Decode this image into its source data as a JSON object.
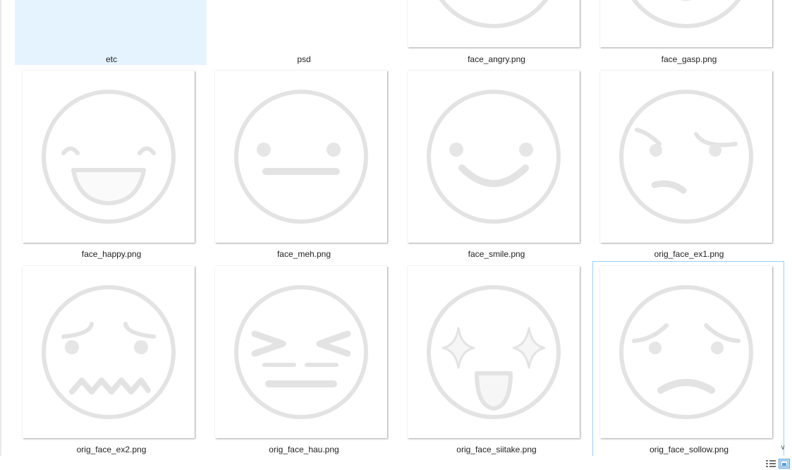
{
  "items": [
    {
      "label": "etc",
      "kind": "folder",
      "icon": "folder-icon"
    },
    {
      "label": "psd",
      "kind": "folder",
      "icon": "folder-icon"
    },
    {
      "label": "face_angry.png",
      "kind": "image",
      "face": "face-angry"
    },
    {
      "label": "face_gasp.png",
      "kind": "image",
      "face": "face-gasp"
    },
    {
      "label": "face_happy.png",
      "kind": "image",
      "face": "face-happy"
    },
    {
      "label": "face_meh.png",
      "kind": "image",
      "face": "face-meh"
    },
    {
      "label": "face_smile.png",
      "kind": "image",
      "face": "face-smile"
    },
    {
      "label": "orig_face_ex1.png",
      "kind": "image",
      "face": "face-ex1"
    },
    {
      "label": "orig_face_ex2.png",
      "kind": "image",
      "face": "face-ex2"
    },
    {
      "label": "orig_face_hau.png",
      "kind": "image",
      "face": "face-hau"
    },
    {
      "label": "orig_face_siitake.png",
      "kind": "image",
      "face": "face-siitake"
    },
    {
      "label": "orig_face_sollow.png",
      "kind": "image",
      "face": "face-sollow"
    }
  ],
  "selected_item": "etc",
  "focused_item": "orig_face_sollow.png",
  "statusbar": {
    "details_view_icon": "details-view-icon",
    "large_icons_view_icon": "large-icons-view-icon"
  },
  "colors": {
    "selection": "#e5f3ff",
    "focus_border": "#99d1ff",
    "folder_yellow": "#f8d775",
    "face_stroke": "#e3e3e3"
  }
}
